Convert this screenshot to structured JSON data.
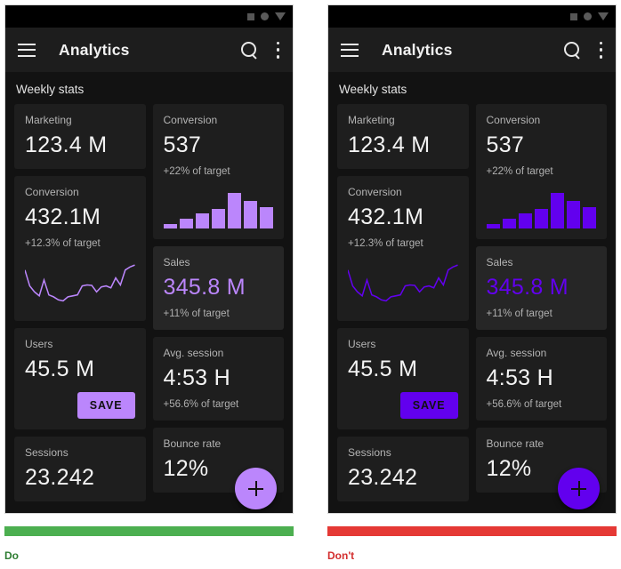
{
  "meta": {
    "figure_kind": "material-design-do-dont-comparison"
  },
  "statusbar": {
    "icons": [
      "square-icon",
      "circle-icon",
      "triangle-down-icon"
    ]
  },
  "appbar": {
    "menu_icon": "hamburger-menu-icon",
    "title": "Analytics",
    "search_icon": "search-icon",
    "overflow_icon": "more-vertical-icon"
  },
  "content": {
    "section_title": "Weekly stats"
  },
  "cards": [
    {
      "id": "marketing",
      "label": "Marketing",
      "value": "123.4 M",
      "sub": "",
      "column": 0,
      "elevated": false,
      "accent_value": false,
      "viz": "none"
    },
    {
      "id": "conversion2",
      "label": "Conversion",
      "value": "432.1M",
      "sub": "+12.3% of target",
      "column": 0,
      "elevated": false,
      "accent_value": false,
      "viz": "sparkline"
    },
    {
      "id": "users",
      "label": "Users",
      "value": "45.5 M",
      "sub": "",
      "column": 0,
      "elevated": false,
      "accent_value": false,
      "viz": "button"
    },
    {
      "id": "sessions",
      "label": "Sessions",
      "value": "23.242",
      "sub": "",
      "column": 0,
      "elevated": false,
      "accent_value": false,
      "viz": "none"
    },
    {
      "id": "conversion1",
      "label": "Conversion",
      "value": "537",
      "sub": "+22% of target",
      "column": 1,
      "elevated": false,
      "accent_value": false,
      "viz": "barchart"
    },
    {
      "id": "sales",
      "label": "Sales",
      "value": "345.8 M",
      "sub": "+11% of target",
      "column": 1,
      "elevated": true,
      "accent_value": true,
      "viz": "none"
    },
    {
      "id": "avgsession",
      "label": "Avg. session",
      "value": "4:53 H",
      "sub": "+56.6% of target",
      "column": 1,
      "elevated": false,
      "accent_value": false,
      "viz": "none"
    },
    {
      "id": "bouncerate",
      "label": "Bounce rate",
      "value": "12%",
      "sub": "",
      "column": 1,
      "elevated": false,
      "accent_value": false,
      "viz": "none"
    }
  ],
  "save_button": {
    "label": "SAVE"
  },
  "fab": {
    "icon": "plus-icon"
  },
  "chart_data": [
    {
      "type": "bar",
      "id": "conversion-bar-chart",
      "title": "Conversion",
      "categories": [
        "1",
        "2",
        "3",
        "4",
        "5",
        "6",
        "7"
      ],
      "values": [
        12,
        24,
        38,
        48,
        88,
        68,
        52
      ],
      "ylim": [
        0,
        100
      ],
      "xlabel": "",
      "ylabel": "",
      "grid": false,
      "legend": "none"
    },
    {
      "type": "line",
      "id": "conversion-sparkline",
      "title": "Conversion",
      "x": [
        0,
        1,
        2,
        3,
        4,
        5,
        6,
        7,
        8,
        9,
        10,
        11,
        12,
        13,
        14,
        15,
        16,
        17,
        18,
        19,
        20,
        21,
        22,
        23
      ],
      "values": [
        72,
        40,
        28,
        20,
        52,
        22,
        18,
        12,
        10,
        18,
        20,
        22,
        40,
        42,
        41,
        28,
        38,
        40,
        36,
        56,
        42,
        72,
        78,
        82
      ],
      "ylim": [
        0,
        100
      ],
      "xlabel": "",
      "ylabel": "",
      "grid": false,
      "legend": "none"
    }
  ],
  "panels": [
    {
      "id": "do",
      "accent": "#BB86FC",
      "on_accent": "#111111",
      "caption": "Do",
      "caption_color": "#2e7d32",
      "bar_color": "#4caf50"
    },
    {
      "id": "dont",
      "accent": "#6200EE",
      "on_accent": "#111111",
      "caption": "Don't",
      "caption_color": "#d32f2f",
      "bar_color": "#e53935"
    }
  ]
}
